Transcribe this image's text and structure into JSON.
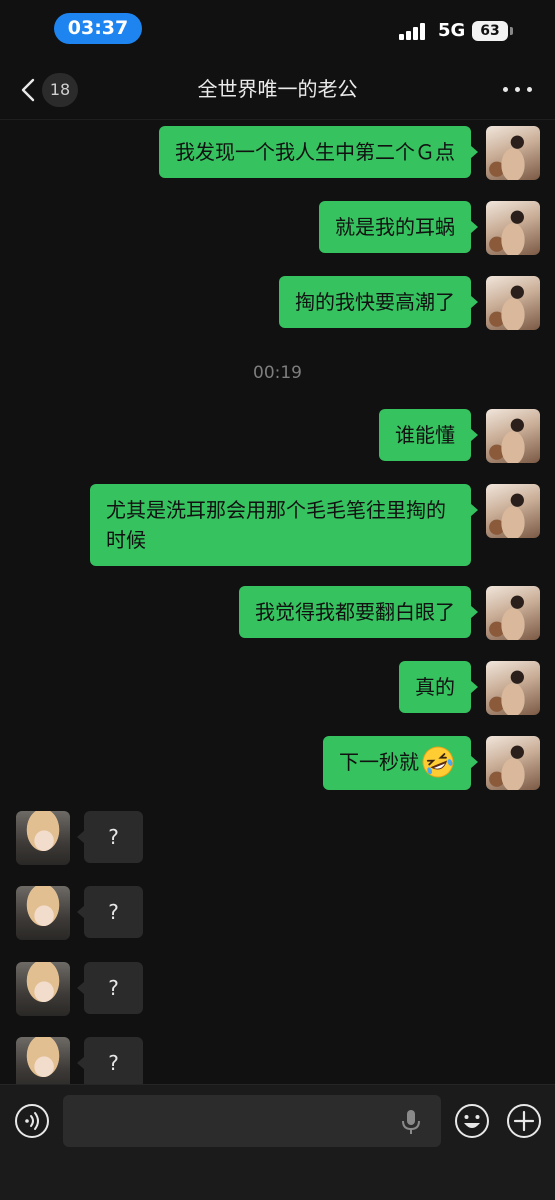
{
  "status_bar": {
    "time": "03:37",
    "network": "5G",
    "battery": "63"
  },
  "nav": {
    "unread_count": "18",
    "title": "全世界唯一的老公"
  },
  "messages": [
    {
      "sender": "self",
      "text": "我发现一个我人生中第二个Ｇ点"
    },
    {
      "sender": "self",
      "text": "就是我的耳蜗"
    },
    {
      "sender": "self",
      "text": "掏的我快要高潮了"
    },
    {
      "type": "timestamp",
      "text": "00:19"
    },
    {
      "sender": "self",
      "text": "谁能懂"
    },
    {
      "sender": "self",
      "text": "尤其是洗耳那会用那个毛毛笔往里掏的时候"
    },
    {
      "sender": "self",
      "text": "我觉得我都要翻白眼了"
    },
    {
      "sender": "self",
      "text": "真的"
    },
    {
      "sender": "self",
      "text": "下一秒就",
      "emoji": "rolling-on-floor-laughing-emoji"
    },
    {
      "sender": "other",
      "text": "?"
    },
    {
      "sender": "other",
      "text": "?"
    },
    {
      "sender": "other",
      "text": "?"
    },
    {
      "sender": "other",
      "text": "?"
    }
  ],
  "input_bar": {
    "placeholder": ""
  },
  "icons": {
    "back": "chevron-left-icon",
    "more": "more-dots-icon",
    "voice": "voice-icon",
    "mic": "mic-icon",
    "emoji": "emoji-icon",
    "plus": "plus-icon"
  },
  "colors": {
    "self_bubble": "#35c25f",
    "other_bubble": "#2b2b2b",
    "background": "#111111",
    "time_pill": "#1e84f0"
  }
}
